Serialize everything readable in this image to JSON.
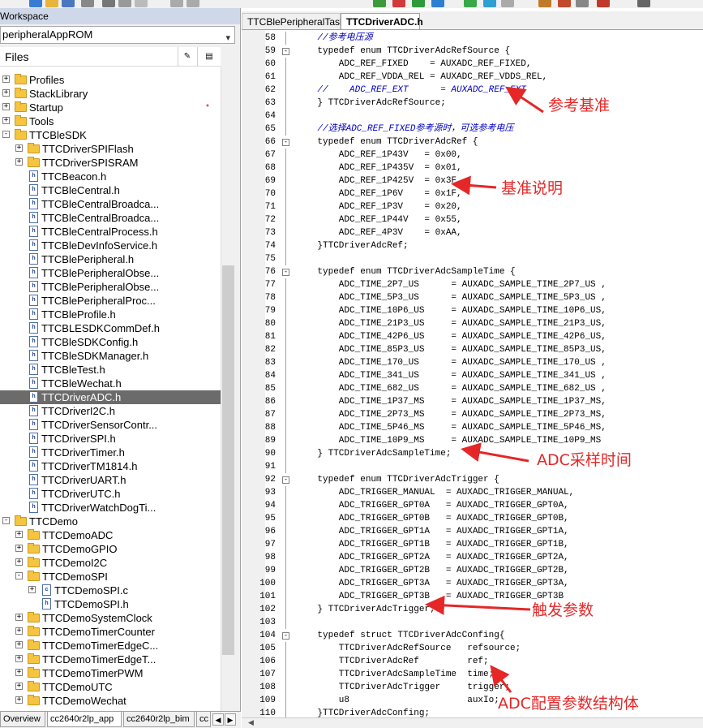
{
  "workspace": {
    "title": "Workspace",
    "project": "peripheralAppROM",
    "files_header": "Files",
    "col1_icon": "config-icon",
    "col2_icon": "build-icon",
    "tree": [
      {
        "label": "Profiles",
        "type": "folder",
        "level": 0,
        "toggle": "+"
      },
      {
        "label": "StackLibrary",
        "type": "folder",
        "level": 0,
        "toggle": "+"
      },
      {
        "label": "Startup",
        "type": "folder",
        "level": 0,
        "toggle": "+",
        "marker": "*"
      },
      {
        "label": "Tools",
        "type": "folder",
        "level": 0,
        "toggle": "+"
      },
      {
        "label": "TTCBleSDK",
        "type": "folder",
        "level": 0,
        "toggle": "-"
      },
      {
        "label": "TTCDriverSPIFlash",
        "type": "folder",
        "level": 1,
        "toggle": "+"
      },
      {
        "label": "TTCDriverSPISRAM",
        "type": "folder",
        "level": 1,
        "toggle": "+"
      },
      {
        "label": "TTCBeacon.h",
        "type": "file",
        "level": 1
      },
      {
        "label": "TTCBleCentral.h",
        "type": "file",
        "level": 1
      },
      {
        "label": "TTCBleCentralBroadca...",
        "type": "file",
        "level": 1
      },
      {
        "label": "TTCBleCentralBroadca...",
        "type": "file",
        "level": 1
      },
      {
        "label": "TTCBleCentralProcess.h",
        "type": "file",
        "level": 1
      },
      {
        "label": "TTCBleDevInfoService.h",
        "type": "file",
        "level": 1
      },
      {
        "label": "TTCBlePeripheral.h",
        "type": "file",
        "level": 1
      },
      {
        "label": "TTCBlePeripheralObse...",
        "type": "file",
        "level": 1
      },
      {
        "label": "TTCBlePeripheralObse...",
        "type": "file",
        "level": 1
      },
      {
        "label": "TTCBlePeripheralProc...",
        "type": "file",
        "level": 1
      },
      {
        "label": "TTCBleProfile.h",
        "type": "file",
        "level": 1
      },
      {
        "label": "TTCBLESDKCommDef.h",
        "type": "file",
        "level": 1
      },
      {
        "label": "TTCBleSDKConfig.h",
        "type": "file",
        "level": 1
      },
      {
        "label": "TTCBleSDKManager.h",
        "type": "file",
        "level": 1
      },
      {
        "label": "TTCBleTest.h",
        "type": "file",
        "level": 1
      },
      {
        "label": "TTCBleWechat.h",
        "type": "file",
        "level": 1
      },
      {
        "label": "TTCDriverADC.h",
        "type": "file",
        "level": 1,
        "selected": true
      },
      {
        "label": "TTCDriverI2C.h",
        "type": "file",
        "level": 1
      },
      {
        "label": "TTCDriverSensorContr...",
        "type": "file",
        "level": 1
      },
      {
        "label": "TTCDriverSPI.h",
        "type": "file",
        "level": 1
      },
      {
        "label": "TTCDriverTimer.h",
        "type": "file",
        "level": 1
      },
      {
        "label": "TTCDriverTM1814.h",
        "type": "file",
        "level": 1
      },
      {
        "label": "TTCDriverUART.h",
        "type": "file",
        "level": 1
      },
      {
        "label": "TTCDriverUTC.h",
        "type": "file",
        "level": 1
      },
      {
        "label": "TTCDriverWatchDogTi...",
        "type": "file",
        "level": 1
      },
      {
        "label": "TTCDemo",
        "type": "folder",
        "level": 0,
        "toggle": "-"
      },
      {
        "label": "TTCDemoADC",
        "type": "folder",
        "level": 1,
        "toggle": "+"
      },
      {
        "label": "TTCDemoGPIO",
        "type": "folder",
        "level": 1,
        "toggle": "+"
      },
      {
        "label": "TTCDemoI2C",
        "type": "folder",
        "level": 1,
        "toggle": "+"
      },
      {
        "label": "TTCDemoSPI",
        "type": "folder",
        "level": 1,
        "toggle": "-"
      },
      {
        "label": "TTCDemoSPI.c",
        "type": "file",
        "level": 2,
        "toggle": "+",
        "letter": "c"
      },
      {
        "label": "TTCDemoSPI.h",
        "type": "file",
        "level": 2
      },
      {
        "label": "TTCDemoSystemClock",
        "type": "folder",
        "level": 1,
        "toggle": "+"
      },
      {
        "label": "TTCDemoTimerCounter",
        "type": "folder",
        "level": 1,
        "toggle": "+"
      },
      {
        "label": "TTCDemoTimerEdgeC...",
        "type": "folder",
        "level": 1,
        "toggle": "+"
      },
      {
        "label": "TTCDemoTimerEdgeT...",
        "type": "folder",
        "level": 1,
        "toggle": "+"
      },
      {
        "label": "TTCDemoTimerPWM",
        "type": "folder",
        "level": 1,
        "toggle": "+"
      },
      {
        "label": "TTCDemoUTC",
        "type": "folder",
        "level": 1,
        "toggle": "+"
      },
      {
        "label": "TTCDemoWechat",
        "type": "folder",
        "level": 1,
        "toggle": "+"
      }
    ],
    "bottom_tabs": [
      "Overview",
      "cc2640r2lp_app",
      "cc2640r2lp_bim",
      "cc"
    ]
  },
  "editor": {
    "tabs": [
      "TTCBlePeripheralTask.c",
      "TTCDriverADC.h"
    ],
    "active_tab": 1,
    "lines": [
      {
        "n": "58",
        "t": "    //参考电压源",
        "c": true
      },
      {
        "n": "59",
        "t": "    typedef enum TTCDriverAdcRefSource {",
        "fold": "-"
      },
      {
        "n": "60",
        "t": "        ADC_REF_FIXED    = AUXADC_REF_FIXED,"
      },
      {
        "n": "61",
        "t": "        ADC_REF_VDDA_REL = AUXADC_REF_VDDS_REL,"
      },
      {
        "n": "62",
        "t": "    //    ADC_REF_EXT      = AUXADC_REF_EXT",
        "c": true
      },
      {
        "n": "63",
        "t": "    } TTCDriverAdcRefSource;",
        "end": true
      },
      {
        "n": "64",
        "t": ""
      },
      {
        "n": "65",
        "t": "    //选择ADC_REF_FIXED参考源时，可选参考电压",
        "c": true
      },
      {
        "n": "66",
        "t": "    typedef enum TTCDriverAdcRef {",
        "fold": "-"
      },
      {
        "n": "67",
        "t": "        ADC_REF_1P43V   = 0x00,"
      },
      {
        "n": "68",
        "t": "        ADC_REF_1P435V  = 0x01,"
      },
      {
        "n": "69",
        "t": "        ADC_REF_1P425V  = 0x3F,"
      },
      {
        "n": "70",
        "t": "        ADC_REF_1P6V    = 0x1F,"
      },
      {
        "n": "71",
        "t": "        ADC_REF_1P3V    = 0x20,"
      },
      {
        "n": "72",
        "t": "        ADC_REF_1P44V   = 0x55,"
      },
      {
        "n": "73",
        "t": "        ADC_REF_4P3V    = 0xAA,"
      },
      {
        "n": "74",
        "t": "    }TTCDriverAdcRef;",
        "end": true
      },
      {
        "n": "75",
        "t": ""
      },
      {
        "n": "76",
        "t": "    typedef enum TTCDriverAdcSampleTime {",
        "fold": "-"
      },
      {
        "n": "77",
        "t": "        ADC_TIME_2P7_US      = AUXADC_SAMPLE_TIME_2P7_US ,"
      },
      {
        "n": "78",
        "t": "        ADC_TIME_5P3_US      = AUXADC_SAMPLE_TIME_5P3_US ,"
      },
      {
        "n": "79",
        "t": "        ADC_TIME_10P6_US     = AUXADC_SAMPLE_TIME_10P6_US,"
      },
      {
        "n": "80",
        "t": "        ADC_TIME_21P3_US     = AUXADC_SAMPLE_TIME_21P3_US,"
      },
      {
        "n": "81",
        "t": "        ADC_TIME_42P6_US     = AUXADC_SAMPLE_TIME_42P6_US,"
      },
      {
        "n": "82",
        "t": "        ADC_TIME_85P3_US     = AUXADC_SAMPLE_TIME_85P3_US,"
      },
      {
        "n": "83",
        "t": "        ADC_TIME_170_US      = AUXADC_SAMPLE_TIME_170_US ,"
      },
      {
        "n": "84",
        "t": "        ADC_TIME_341_US      = AUXADC_SAMPLE_TIME_341_US ,"
      },
      {
        "n": "85",
        "t": "        ADC_TIME_682_US      = AUXADC_SAMPLE_TIME_682_US ,"
      },
      {
        "n": "86",
        "t": "        ADC_TIME_1P37_MS     = AUXADC_SAMPLE_TIME_1P37_MS,"
      },
      {
        "n": "87",
        "t": "        ADC_TIME_2P73_MS     = AUXADC_SAMPLE_TIME_2P73_MS,"
      },
      {
        "n": "88",
        "t": "        ADC_TIME_5P46_MS     = AUXADC_SAMPLE_TIME_5P46_MS,"
      },
      {
        "n": "89",
        "t": "        ADC_TIME_10P9_MS     = AUXADC_SAMPLE_TIME_10P9_MS"
      },
      {
        "n": "90",
        "t": "    } TTCDriverAdcSampleTime;",
        "end": true
      },
      {
        "n": "91",
        "t": ""
      },
      {
        "n": "92",
        "t": "    typedef enum TTCDriverAdcTrigger {",
        "fold": "-"
      },
      {
        "n": "93",
        "t": "        ADC_TRIGGER_MANUAL  = AUXADC_TRIGGER_MANUAL,"
      },
      {
        "n": "94",
        "t": "        ADC_TRIGGER_GPT0A   = AUXADC_TRIGGER_GPT0A,"
      },
      {
        "n": "95",
        "t": "        ADC_TRIGGER_GPT0B   = AUXADC_TRIGGER_GPT0B,"
      },
      {
        "n": "96",
        "t": "        ADC_TRIGGER_GPT1A   = AUXADC_TRIGGER_GPT1A,"
      },
      {
        "n": "97",
        "t": "        ADC_TRIGGER_GPT1B   = AUXADC_TRIGGER_GPT1B,"
      },
      {
        "n": "98",
        "t": "        ADC_TRIGGER_GPT2A   = AUXADC_TRIGGER_GPT2A,"
      },
      {
        "n": "99",
        "t": "        ADC_TRIGGER_GPT2B   = AUXADC_TRIGGER_GPT2B,"
      },
      {
        "n": "100",
        "t": "        ADC_TRIGGER_GPT3A   = AUXADC_TRIGGER_GPT3A,"
      },
      {
        "n": "101",
        "t": "        ADC_TRIGGER_GPT3B   = AUXADC_TRIGGER_GPT3B"
      },
      {
        "n": "102",
        "t": "    } TTCDriverAdcTrigger;",
        "end": true
      },
      {
        "n": "103",
        "t": ""
      },
      {
        "n": "104",
        "t": "    typedef struct TTCDriverAdcConfing{",
        "fold": "-"
      },
      {
        "n": "105",
        "t": "        TTCDriverAdcRefSource   refsource;"
      },
      {
        "n": "106",
        "t": "        TTCDriverAdcRef         ref;"
      },
      {
        "n": "107",
        "t": "        TTCDriverAdcSampleTime  time;"
      },
      {
        "n": "108",
        "t": "        TTCDriverAdcTrigger     trigger;"
      },
      {
        "n": "109",
        "t": "        u8                      auxIo;"
      },
      {
        "n": "110",
        "t": "    }TTCDriverAdcConfing;",
        "end": true
      }
    ]
  },
  "annotations": [
    {
      "label": "参考基准",
      "color": "#e52727"
    },
    {
      "label": "基准说明",
      "color": "#e52727"
    },
    {
      "label": "ADC采样时间",
      "color": "#e52727"
    },
    {
      "label": "触发参数",
      "color": "#e52727"
    },
    {
      "label": "ADC配置参数结构体",
      "color": "#e52727"
    }
  ]
}
